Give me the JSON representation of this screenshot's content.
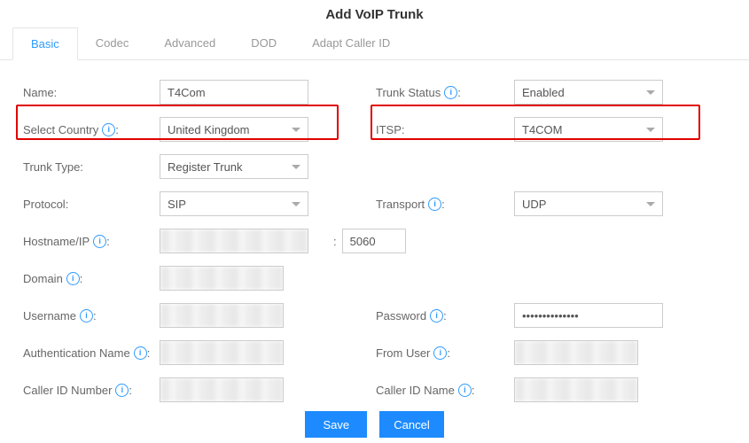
{
  "title": "Add VoIP Trunk",
  "tabs": [
    "Basic",
    "Codec",
    "Advanced",
    "DOD",
    "Adapt Caller ID"
  ],
  "activeTab": 0,
  "labels": {
    "name": "Name:",
    "trunkStatus": "Trunk Status ",
    "selectCountry": "Select Country ",
    "itsp": "ITSP:",
    "trunkType": "Trunk Type:",
    "protocol": "Protocol:",
    "transport": "Transport ",
    "hostname": "Hostname/IP ",
    "domain": "Domain ",
    "username": "Username ",
    "password": "Password ",
    "authName": "Authentication Name ",
    "fromUser": "From User ",
    "callerIdNum": "Caller ID Number ",
    "callerIdName": "Caller ID Name "
  },
  "values": {
    "name": "T4Com",
    "trunkStatus": "Enabled",
    "selectCountry": "United Kingdom",
    "itsp": "T4COM",
    "trunkType": "Register Trunk",
    "protocol": "SIP",
    "transport": "UDP",
    "port": "5060",
    "password": "••••••••••••••"
  },
  "buttons": {
    "save": "Save",
    "cancel": "Cancel"
  }
}
